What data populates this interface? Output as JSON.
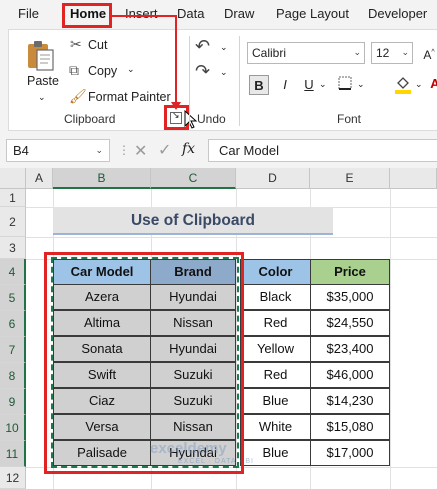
{
  "menu": {
    "tabs": [
      "File",
      "Home",
      "Insert",
      "Data",
      "Draw",
      "Page Layout",
      "Developer"
    ]
  },
  "ribbon": {
    "clipboard": {
      "paste": "Paste",
      "cut": "Cut",
      "copy": "Copy",
      "format_painter": "Format Painter",
      "group_label": "Clipboard"
    },
    "undo": {
      "group_label": "Undo"
    },
    "font": {
      "name": "Calibri",
      "size": "12",
      "bold": "B",
      "group_label": "Font"
    }
  },
  "formula_bar": {
    "name_box": "B4",
    "fx": "fx",
    "value": "Car Model"
  },
  "sheet": {
    "columns": [
      "A",
      "B",
      "C",
      "D",
      "E"
    ],
    "rows": [
      "1",
      "2",
      "3",
      "4",
      "5",
      "6",
      "7",
      "8",
      "9",
      "10",
      "11",
      "12"
    ],
    "title": "Use of Clipboard",
    "headers": [
      "Car Model",
      "Brand",
      "Color",
      "Price"
    ],
    "data": [
      [
        "Azera",
        "Hyundai",
        "Black",
        "$35,000"
      ],
      [
        "Altima",
        "Nissan",
        "Red",
        "$24,550"
      ],
      [
        "Sonata",
        "Hyundai",
        "Yellow",
        "$23,400"
      ],
      [
        "Swift",
        "Suzuki",
        "Red",
        "$46,000"
      ],
      [
        "Ciaz",
        "Suzuki",
        "Blue",
        "$14,230"
      ],
      [
        "Versa",
        "Nissan",
        "White",
        "$15,080"
      ],
      [
        "Palisade",
        "Hyundai",
        "Blue",
        "$17,000"
      ]
    ]
  },
  "colors": {
    "car_model_header": "#9dc3e6",
    "brand_header": "#8eaacb",
    "copied_cells": "#d0d0d0",
    "color_header": "#9dc3e6",
    "price_header": "#a9d08e",
    "highlight": "#e02424",
    "selection": "#217346"
  },
  "watermark": {
    "brand": "exceldemy",
    "tagline": "EXCEL · DATA · BI"
  }
}
